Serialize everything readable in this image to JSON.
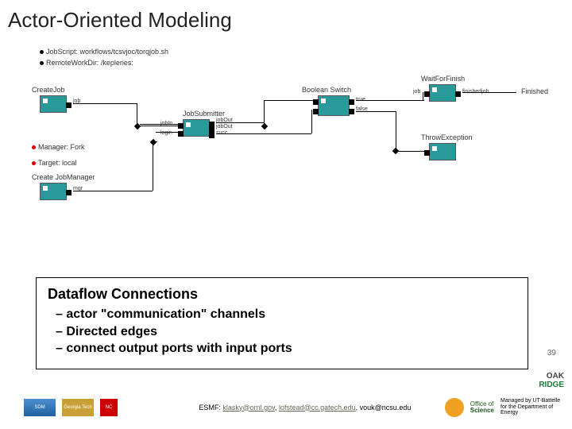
{
  "title": "Actor-Oriented Modeling",
  "params": {
    "jobscript": "JobScript: workflows/tcsvjoc/torqjob.sh",
    "remotework": "RemoteWorkDir: /kepleries:",
    "manager": "Manager: Fork",
    "target": "Target: local"
  },
  "actors": {
    "createjob": "CreateJob",
    "createjobmgr": "Create JobManager",
    "jobsubmitter": "JobSubmitter",
    "boolswitch": "Boolean Switch",
    "waitfinish": "WaitForFinish",
    "throwex": "ThrowException"
  },
  "ports": {
    "job": "job",
    "jobin": "jobIn",
    "jobout": "jobOut",
    "succ": "succ",
    "login": "login",
    "mgr": "mgr",
    "true": "true",
    "false": "false",
    "finishedjob": "finishedjob",
    "job2": "job"
  },
  "textnodes": {
    "finished": "Finished"
  },
  "dataflow": {
    "title": "Dataflow Connections",
    "items": [
      "actor \"communication\" channels",
      "Directed edges",
      "connect output ports with input ports"
    ]
  },
  "footer": {
    "esmf": "ESMF: ",
    "email1": "klasky@ornl.gov",
    "email2": "lofstead@cc.gatech.edu",
    "email3": "vouk@ncsu.edu",
    "managed": "Managed by UT-Battelle for the Department of Energy",
    "office": "Office of",
    "science": "Science",
    "oak": "OAK",
    "ridge": "RIDGE"
  },
  "pagenum": "39",
  "logos": {
    "sdm": "SDM",
    "gt": "Georgia Tech",
    "nc": "NC"
  }
}
